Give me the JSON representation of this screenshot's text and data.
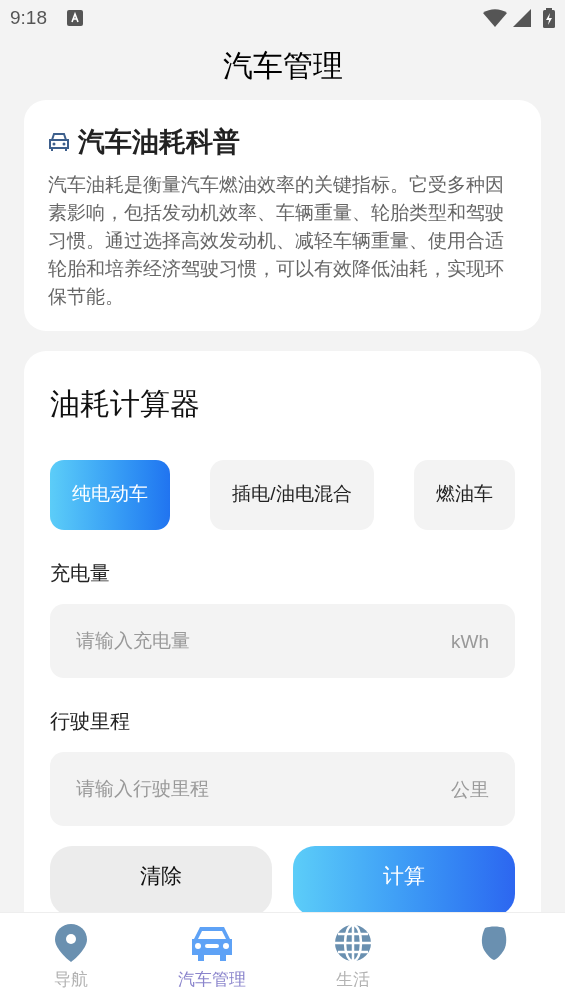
{
  "status_bar": {
    "time": "9:18"
  },
  "header": {
    "title": "汽车管理"
  },
  "info_card": {
    "title": "汽车油耗科普",
    "body": "汽车油耗是衡量汽车燃油效率的关键指标。它受多种因素影响，包括发动机效率、车辆重量、轮胎类型和驾驶习惯。通过选择高效发动机、减轻车辆重量、使用合适轮胎和培养经济驾驶习惯，可以有效降低油耗，实现环保节能。"
  },
  "calculator": {
    "title": "油耗计算器",
    "tabs": [
      {
        "label": "纯电动车",
        "selected": true
      },
      {
        "label": "插电/油电混合",
        "selected": false
      },
      {
        "label": "燃油车",
        "selected": false
      }
    ],
    "fields": [
      {
        "label": "充电量",
        "placeholder": "请输入充电量",
        "unit": "kWh"
      },
      {
        "label": "行驶里程",
        "placeholder": "请输入行驶里程",
        "unit": "公里"
      }
    ],
    "buttons": [
      {
        "label": "清除",
        "kind": "secondary"
      },
      {
        "label": "计算",
        "kind": "primary"
      }
    ]
  },
  "bottom_nav": [
    {
      "label": "导航",
      "kind": "pin",
      "selected": false
    },
    {
      "label": "汽车管理",
      "kind": "car",
      "selected": true
    },
    {
      "label": "生活",
      "kind": "globe",
      "selected": false
    },
    {
      "kind": "shield",
      "selected": false
    }
  ]
}
